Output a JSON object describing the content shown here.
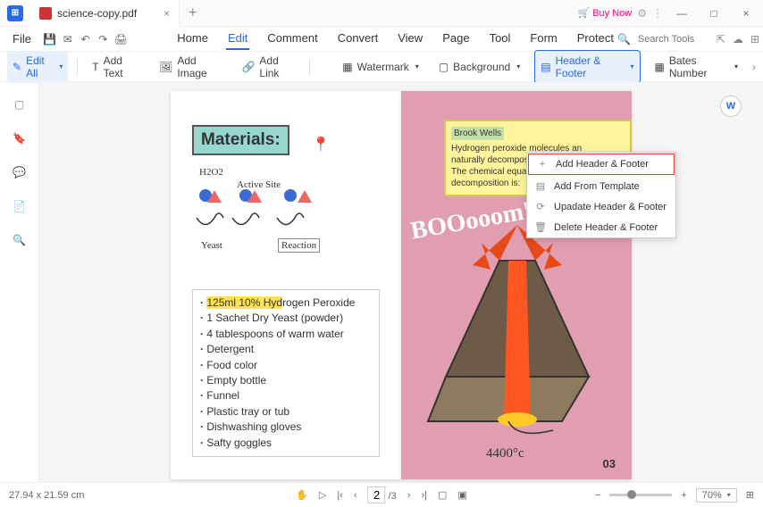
{
  "tab": {
    "title": "science-copy.pdf"
  },
  "titlebar": {
    "buy": "Buy Now"
  },
  "file": "File",
  "menu": {
    "home": "Home",
    "edit": "Edit",
    "comment": "Comment",
    "convert": "Convert",
    "view": "View",
    "page": "Page",
    "tool": "Tool",
    "form": "Form",
    "protect": "Protect"
  },
  "search_placeholder": "Search Tools",
  "toolbar": {
    "edit_all": "Edit All",
    "add_text": "Add Text",
    "add_image": "Add Image",
    "add_link": "Add Link",
    "watermark": "Watermark",
    "background": "Background",
    "header_footer": "Header & Footer",
    "bates": "Bates Number"
  },
  "dropdown": {
    "add": "Add Header & Footer",
    "template": "Add From Template",
    "update": "Upadate Header & Footer",
    "delete": "Delete Header & Footer"
  },
  "page1": {
    "title": "Materials:",
    "sketch": {
      "h2o2": "H2O2",
      "active_site": "Active Site",
      "yeast": "Yeast",
      "reaction": "Reaction"
    },
    "items": [
      "125ml 10% Hydrogen Peroxide",
      "1 Sachet Dry Yeast (powder)",
      "4 tablespoons of warm water",
      "Detergent",
      "Food color",
      "Empty bottle",
      "Funnel",
      "Plastic tray or tub",
      "Dishwashing gloves",
      "Safty goggles"
    ]
  },
  "page2": {
    "note_author": "Brook Wells",
    "note1": "Hydrogen peroxide molecules an",
    "note2": "naturally decompose into water a",
    "note3": "The chemical equation for this decomposition is:",
    "boom": "BOOooom!",
    "temp": "4400°c",
    "num": "03"
  },
  "status": {
    "dims": "27.94 x 21.59 cm",
    "page": "2",
    "total": "/3",
    "zoom": "70%"
  }
}
